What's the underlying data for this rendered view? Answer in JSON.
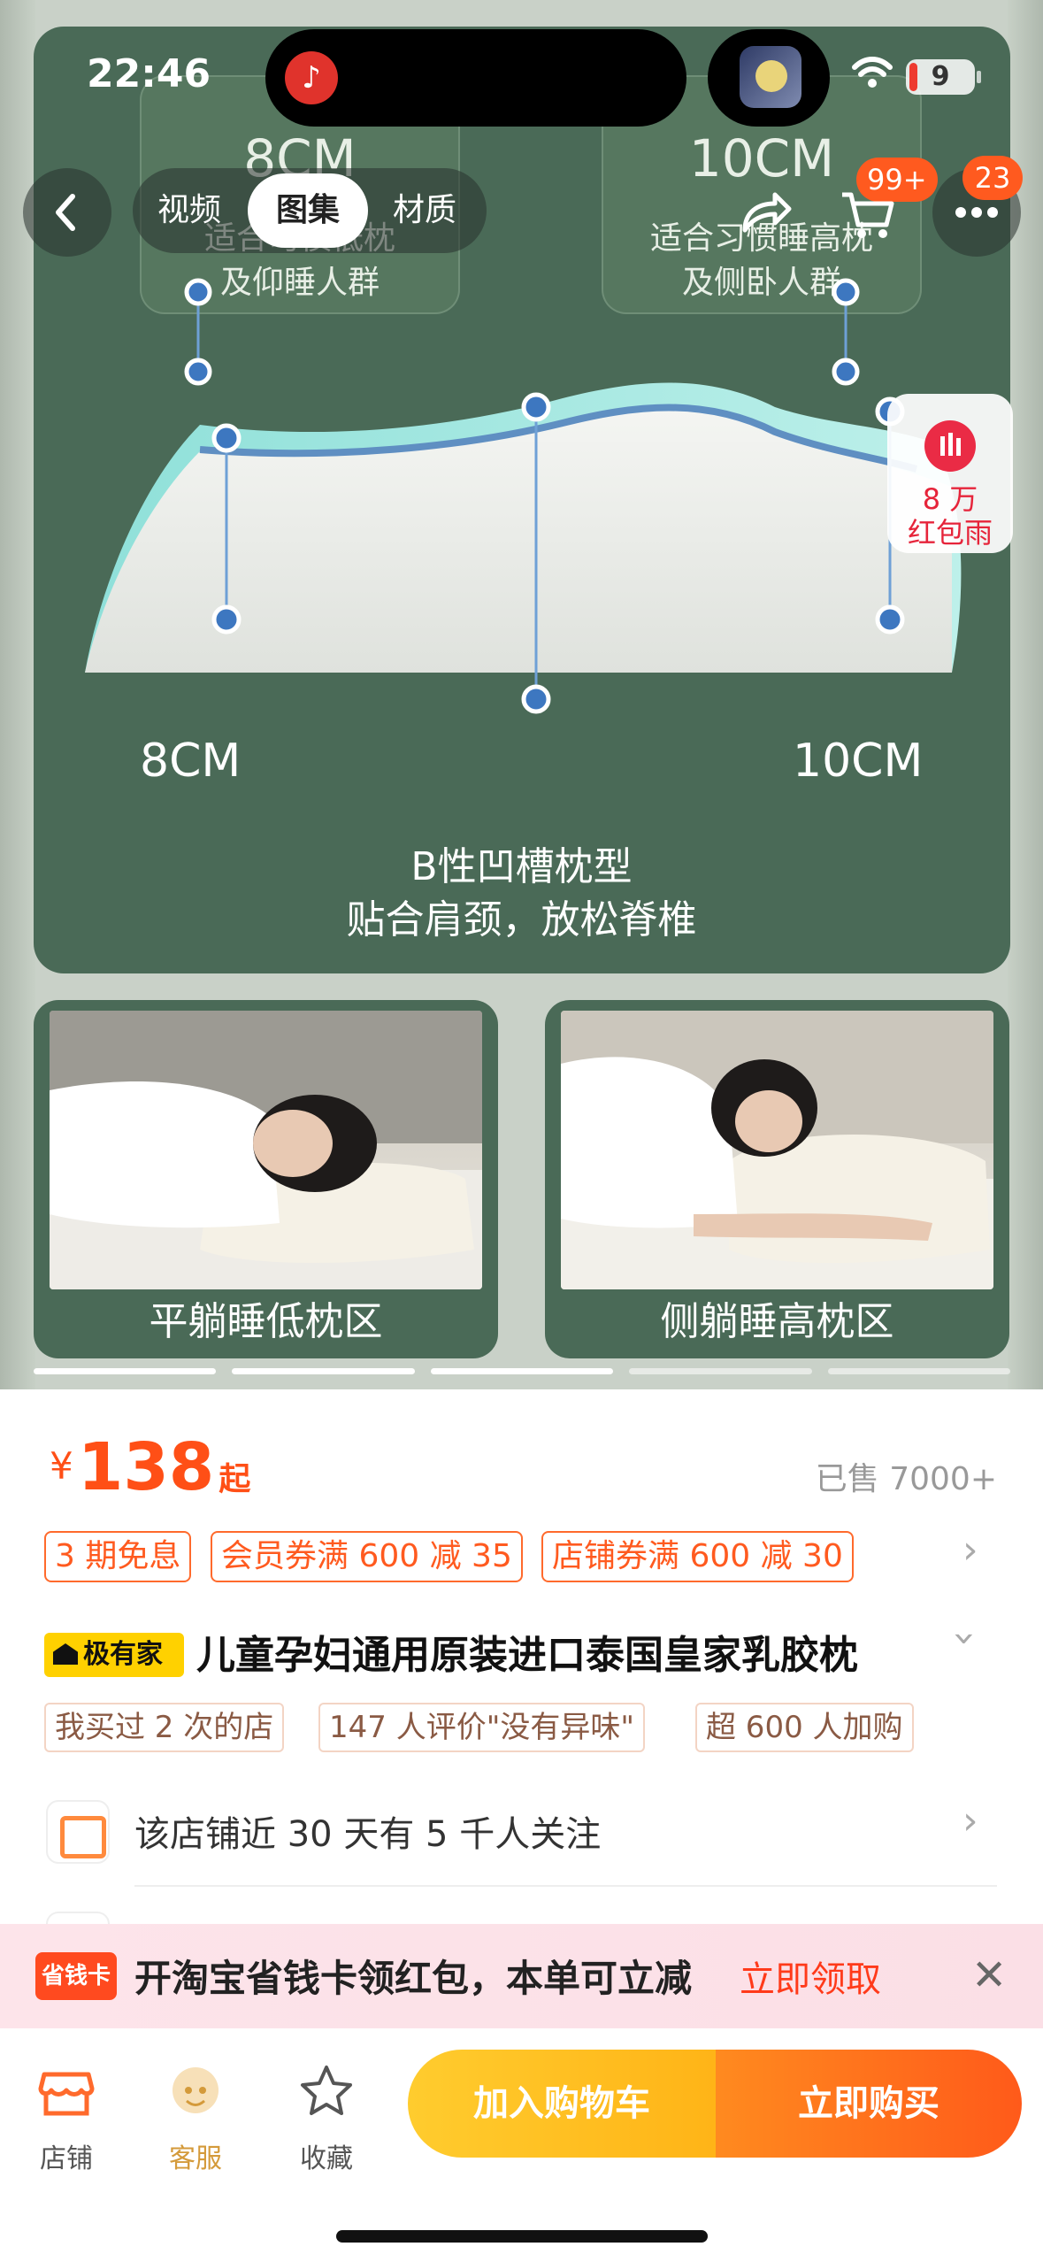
{
  "status_bar": {
    "time": "22:46",
    "battery": "9"
  },
  "nav": {
    "tabs": [
      "视频",
      "图集",
      "材质"
    ],
    "active_tab": "图集",
    "share_badge": "99+",
    "cart_badge": "23"
  },
  "red_rain": {
    "amount": "8 万",
    "label": "红包雨"
  },
  "gallery": {
    "left_spec": {
      "height": "8CM",
      "desc_line1": "适合习惯低枕",
      "desc_line2": "及仰睡人群"
    },
    "right_spec": {
      "height": "10CM",
      "desc_line1": "适合习惯睡高枕",
      "desc_line2": "及侧卧人群"
    },
    "left_label": "8CM",
    "right_label": "10CM",
    "caption_line1": "B性凹槽枕型",
    "caption_line2": "贴合肩颈，放松脊椎",
    "photo_left_caption": "平躺睡低枕区",
    "photo_right_caption": "侧躺睡高枕区",
    "page_count": 5,
    "current_page": 3
  },
  "product": {
    "currency": "¥",
    "price": "138",
    "price_suffix": "起",
    "sold": "已售 7000+",
    "promos": [
      "3 期免息",
      "会员券满 600 减 35",
      "店铺券满 600 减 30"
    ],
    "brand_tag": "极有家",
    "title": "儿童孕妇通用原装进口泰国皇家乳胶枕",
    "chips": [
      "我买过 2 次的店",
      "147 人评价\"没有异味\"",
      "超 600 人加购"
    ],
    "shop_follow": "该店铺近 30 天有 5 千人关注"
  },
  "banner": {
    "tag": "省钱卡",
    "text": "开淘宝省钱卡领红包，本单可立减",
    "action": "立即领取"
  },
  "bottom_bar": {
    "shop": "店铺",
    "service": "客服",
    "favorite": "收藏",
    "add_to_cart": "加入购物车",
    "buy_now": "立即购买"
  },
  "colors": {
    "accent": "#ff4f16",
    "panel_green": "#4a6a57",
    "cart_yellow": "#ffb417"
  }
}
